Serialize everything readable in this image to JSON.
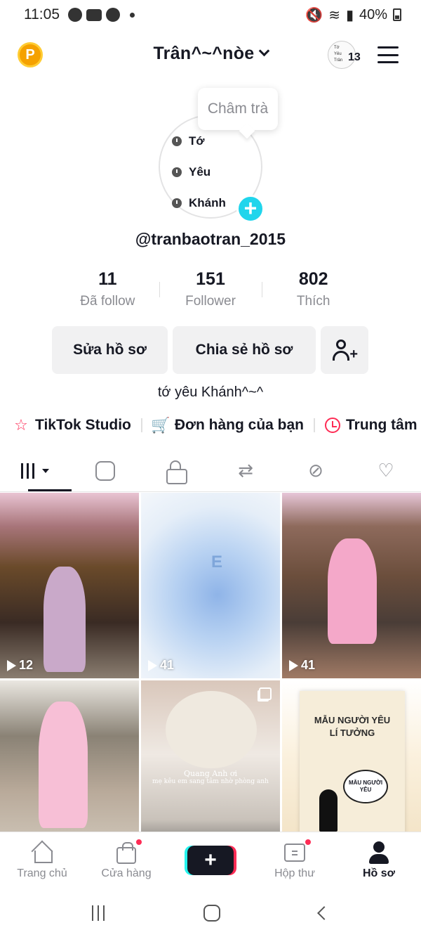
{
  "status_bar": {
    "time": "11:05",
    "battery": "40%"
  },
  "header": {
    "username_title": "Trân^~^nòe",
    "story_count": "13",
    "story_lines": [
      "Tớ",
      "Yêu",
      "Trân"
    ]
  },
  "note_bubble": "Châm trà",
  "avatar_lines": [
    "Tớ",
    "Yêu",
    "Khánh"
  ],
  "profile": {
    "handle": "@tranbaotran_2015",
    "bio": "tớ yêu Khánh^~^"
  },
  "stats": [
    {
      "value": "11",
      "label": "Đã follow"
    },
    {
      "value": "151",
      "label": "Follower"
    },
    {
      "value": "802",
      "label": "Thích"
    }
  ],
  "buttons": {
    "edit": "Sửa hồ sơ",
    "share": "Chia sẻ hồ sơ"
  },
  "quick_links": [
    "TikTok Studio",
    "Đơn hàng của bạn",
    "Trung tâm"
  ],
  "videos": [
    {
      "views": "12"
    },
    {
      "views": "41",
      "overlay": "E"
    },
    {
      "views": "41"
    },
    {
      "views": ""
    },
    {
      "views": "",
      "caption_line1": "Quang Anh ơi",
      "caption_line2": "mẹ kêu em sang tâm nhờ phòng anh"
    },
    {
      "views": "",
      "poster_title_1": "MẪU NGƯỜI YÊU",
      "poster_title_2": "LÍ TƯỞNG",
      "poster_cloud": "MẪU NGƯỜI YÊU"
    }
  ],
  "bottom_nav": [
    {
      "label": "Trang chủ"
    },
    {
      "label": "Cửa hàng"
    },
    {
      "label": ""
    },
    {
      "label": "Hộp thư"
    },
    {
      "label": "Hồ sơ"
    }
  ],
  "colors": {
    "accent": "#fe2c55",
    "cyan": "#25f4ee",
    "text": "#161823",
    "muted": "#8a8b91"
  }
}
